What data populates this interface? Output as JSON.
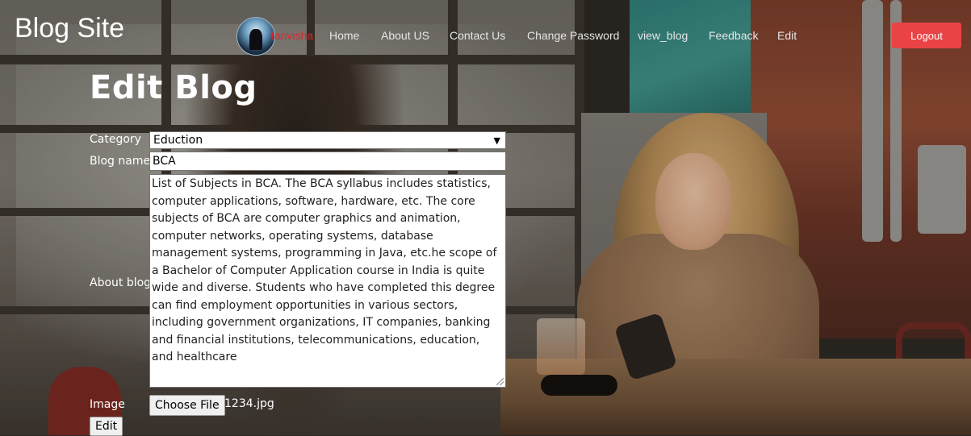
{
  "nav": {
    "brand": "Blog Site",
    "username": "tanvisha",
    "links": [
      "Home",
      "About US",
      "Contact Us",
      "Change Password",
      "view_blog",
      "Feedback",
      "Edit"
    ],
    "logout": "Logout"
  },
  "form": {
    "title": "Edit Blog",
    "category_label": "Category",
    "category_value": "Eduction",
    "blog_name_label": "Blog name",
    "blog_name_value": "BCA",
    "about_label": "About blog",
    "about_value": "List of Subjects in BCA. The BCA syllabus includes statistics, computer applications, software, hardware, etc. The core subjects of BCA are computer graphics and animation, computer networks, operating systems, database management systems, programming in Java, etc.he scope of a Bachelor of Computer Application course in India is quite wide and diverse. Students who have completed this degree can find employment opportunities in various sectors, including government organizations, IT companies, banking and financial institutions, telecommunications, education, and healthcare",
    "image_label": "Image",
    "choose_file": "Choose File",
    "file_name": "1234.jpg",
    "submit": "Edit"
  },
  "icons": {
    "select_chevron": "chevron-down-icon",
    "avatar": "user-avatar"
  },
  "colors": {
    "logout_bg": "#e94346",
    "username": "#e0262d"
  }
}
